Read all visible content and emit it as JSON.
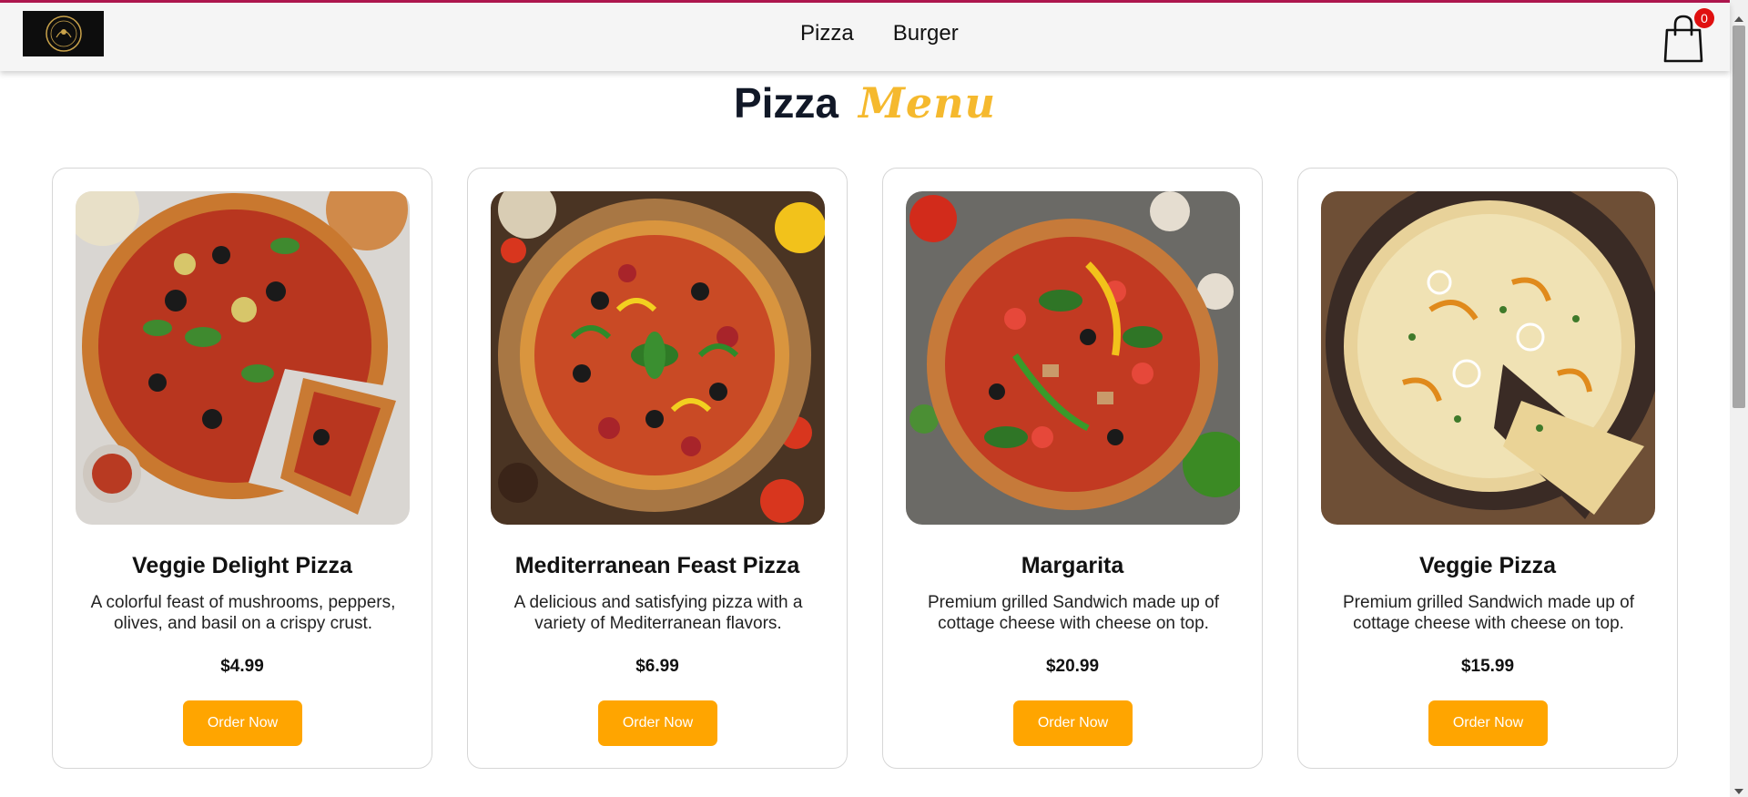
{
  "nav": {
    "links": [
      "Pizza",
      "Burger"
    ],
    "cart_count": "0"
  },
  "heading": {
    "word1": "Pizza",
    "word2": "Menu"
  },
  "colors": {
    "accent": "#ffa500",
    "title_accent": "#f5b92e",
    "badge": "#e01010",
    "top_line": "#b0174f"
  },
  "items": [
    {
      "name": "Veggie Delight Pizza",
      "desc": "A colorful feast of mushrooms, peppers, olives, and basil on a crispy crust.",
      "price": "$4.99",
      "button": "Order Now"
    },
    {
      "name": "Mediterranean Feast Pizza",
      "desc": "A delicious and satisfying pizza with a variety of Mediterranean flavors.",
      "price": "$6.99",
      "button": "Order Now"
    },
    {
      "name": "Margarita",
      "desc": "Premium grilled Sandwich made up of cottage cheese with cheese on top.",
      "price": "$20.99",
      "button": "Order Now"
    },
    {
      "name": "Veggie Pizza",
      "desc": "Premium grilled Sandwich made up of cottage cheese with cheese on top.",
      "price": "$15.99",
      "button": "Order Now"
    }
  ]
}
